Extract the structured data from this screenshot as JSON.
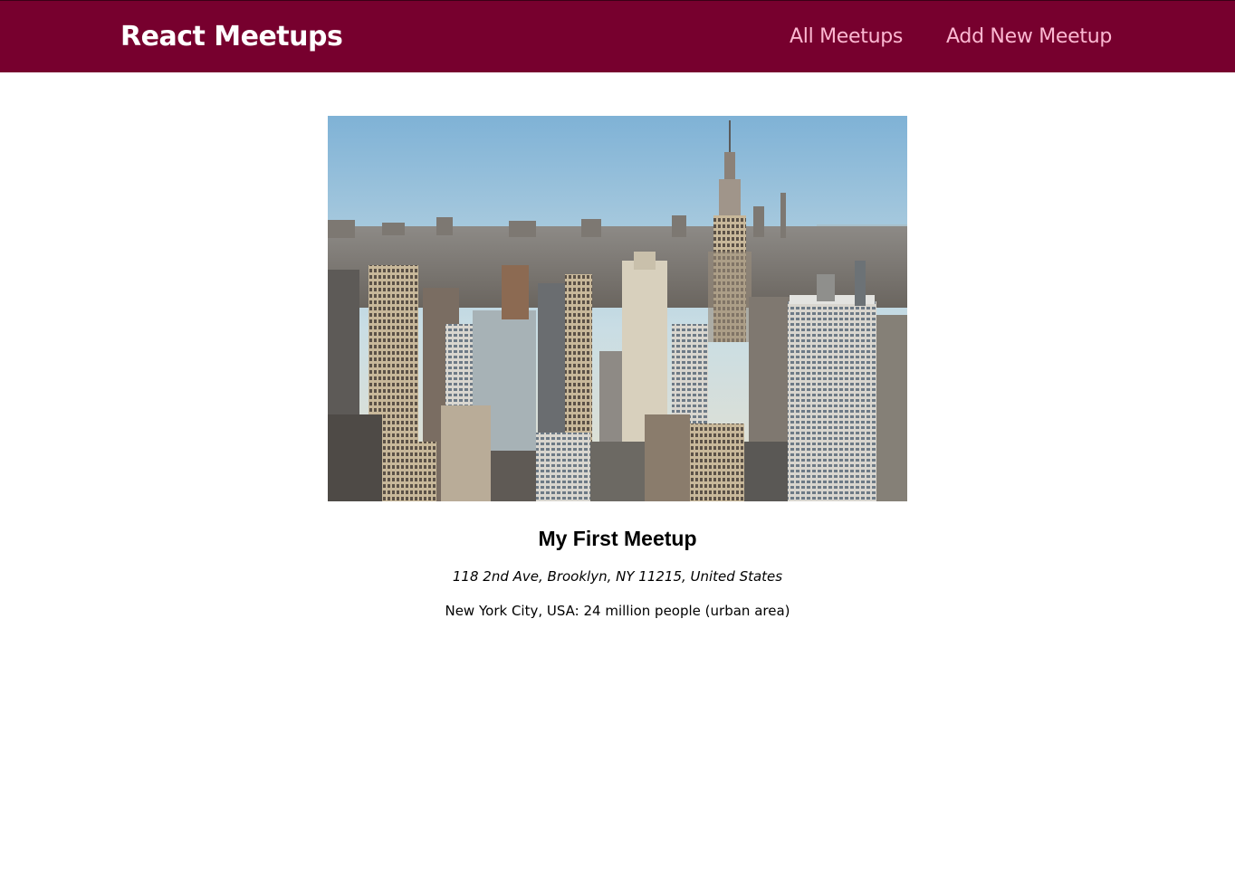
{
  "header": {
    "logo": "React Meetups",
    "nav": {
      "all_meetups": "All Meetups",
      "add_meetup": "Add New Meetup"
    }
  },
  "meetup": {
    "title": "My First Meetup",
    "address": "118 2nd Ave, Brooklyn, NY 11215, United States",
    "description": "New York City, USA: 24 million people (urban area)"
  },
  "colors": {
    "header_bg": "#77002e",
    "nav_link": "#fcb8d2",
    "logo": "#ffffff"
  }
}
